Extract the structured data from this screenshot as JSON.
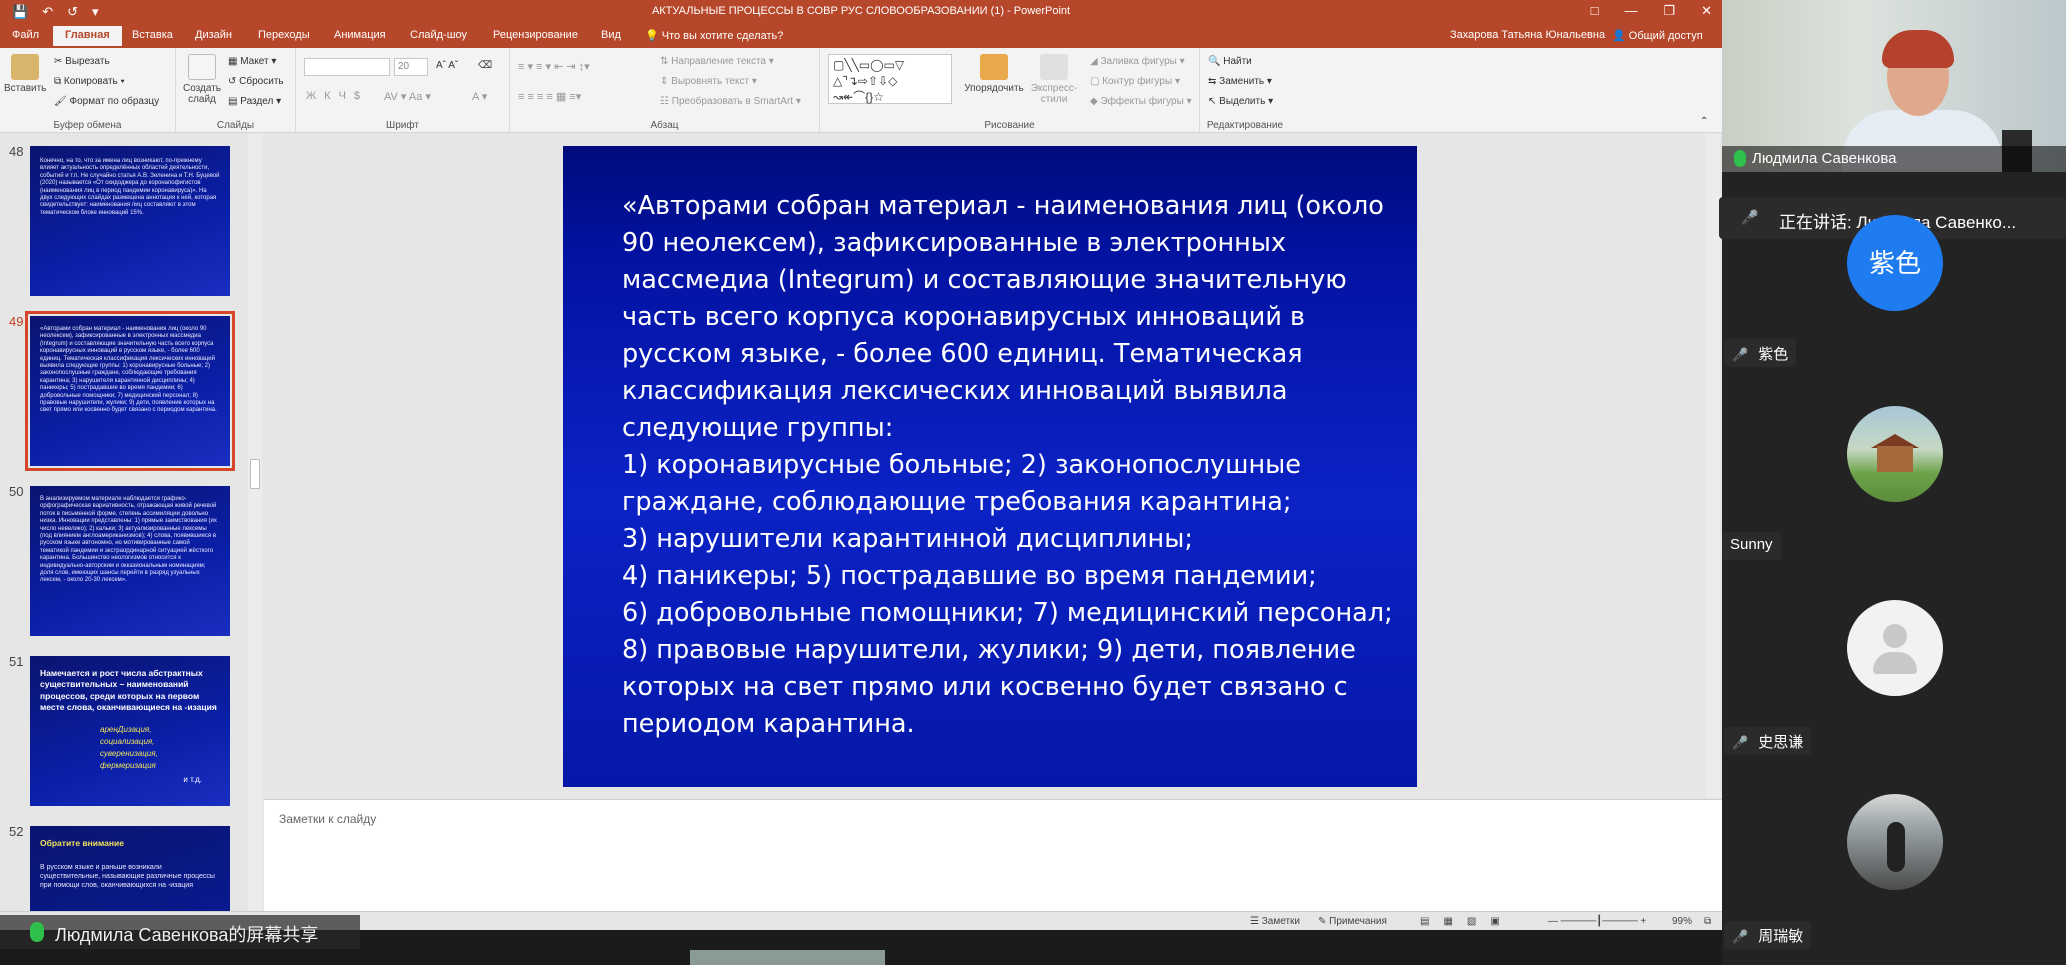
{
  "titlebar": {
    "title": "АКТУАЛЬНЫЕ ПРОЦЕССЫ В СОВР РУС СЛОВООБРАЗОВАНИИ (1) - PowerPoint",
    "save_icon": "save-icon",
    "undo_icon": "undo-icon",
    "redo_icon": "redo-icon"
  },
  "tabs": {
    "file": "Файл",
    "home": "Главная",
    "insert": "Вставка",
    "design": "Дизайн",
    "transitions": "Переходы",
    "animations": "Анимация",
    "slideshow": "Слайд-шоу",
    "review": "Рецензирование",
    "view": "Вид",
    "tell_me": "Что вы хотите сделать?",
    "user": "Захарова Татьяна Юнальевна",
    "share": "Общий доступ"
  },
  "ribbon": {
    "paste": "Вставить",
    "cut": "Вырезать",
    "copy": "Копировать",
    "format_painter": "Формат по образцу",
    "clipboard_group": "Буфер обмена",
    "new_slide": "Создать слайд",
    "layout": "Макет",
    "reset": "Сбросить",
    "section": "Раздел",
    "slides_group": "Слайды",
    "font_size": "20",
    "font_group": "Шрифт",
    "text_direction": "Направление текста",
    "align_text": "Выровнять текст",
    "smartart": "Преобразовать в SmartArt",
    "paragraph_group": "Абзац",
    "arrange": "Упорядочить",
    "quick_styles": "Экспресс-стили",
    "shape_fill": "Заливка фигуры",
    "shape_outline": "Контур фигуры",
    "shape_effects": "Эффекты фигуры",
    "drawing_group": "Рисование",
    "find": "Найти",
    "replace": "Заменить",
    "select": "Выделить",
    "editing_group": "Редактирование"
  },
  "thumbnails": [
    {
      "num": "48",
      "text": "Конечно, на то, что за имена лиц возникают, по-прежнему влияет актуальность определённых областей деятельности, событий и т.п. Не случайно статья А.В. Зеленина и Т.Н. Буцевой (2020) называется «От скидоджера до коронапофигистов (наименования лиц в период пандемии коронавируса)». На двух следующих слайдах размещена аннотация к ней, которая свидетельствует: наименования лиц составляют в этом тематическом блоке инноваций 15%."
    },
    {
      "num": "49",
      "text": "«Авторами собран материал - наименования лиц (около 90 неолексем), зафиксированные в электронных массмедиа (Integrum) и составляющие значительную часть всего корпуса коронавирусных инноваций в русском языке, - более 600 единиц. Тематическая классификация лексических инноваций выявила следующие группы: 1) коронавирусные больные; 2) законопослушные граждане, соблюдающие требования карантина; 3) нарушители карантинной дисциплины; 4) паникеры; 5) пострадавшие во время пандемии; 6) добровольные помощники; 7) медицинский персонал; 8) правовые нарушители, жулики; 9) дети, появление которых на свет прямо или косвенно будет связано с периодом карантина."
    },
    {
      "num": "50",
      "text": "В анализируемом материале наблюдается графико-орфографическая вариативность, отражающая живой речевой поток в письменной форме, степень ассимиляции довольно низка. Инновации представлены: 1) прямые заимствования (их число невелико); 2) кальки; 3) актуализированные лексемы (под влиянием англоамериканизмов); 4) слова, появившиеся в русском языке автономно, но мотивированные самой тематикой пандемии и экстраординарной ситуацией жёсткого карантина. Большинство неологизмов относится к индивидуально-авторским и окказиональным номинациям; доля слов, имеющих шансы перейти в разряд узуальных лексем, - около 20-30 лексем»."
    },
    {
      "num": "51",
      "title": "Намечается и рост числа абстрактных существительных – наименований процессов, среди которых на первом месте слова, оканчивающиеся на -изация",
      "items": [
        "аренДизация,",
        "социализация,",
        "суверенизация,",
        "фермеризация"
      ],
      "tail": "и т.д."
    },
    {
      "num": "52",
      "title": "Обратите внимание",
      "text": "В русском языке и раньше возникали существительные, называющие различные процессы при помощи слов, оканчивающихся на -изация"
    }
  ],
  "slide": {
    "text": "«Авторами собран материал - наименования лиц (около 90 неолексем), зафиксированные в электронных массмедиа (Integrum) и составляющие значительную часть всего корпуса коронавирусных инноваций в русском языке, - более 600 единиц. Тематическая классификация лексических инноваций выявила следующие группы:\n1) коронавирусные больные; 2) законопослушные граждане, соблюдающие требования карантина;\n3) нарушители карантинной дисциплины;\n4) паникеры; 5) пострадавшие во время пандемии;\n6) добровольные помощники; 7) медицинский персонал; 8) правовые нарушители, жулики; 9) дети, появление которых на свет прямо или косвенно будет связано с периодом карантина."
  },
  "notes": {
    "placeholder": "Заметки к слайду"
  },
  "status": {
    "notes": "Заметки",
    "comments": "Примечания",
    "zoom": "99%"
  },
  "share_label": "Людмила Савенкова的屏幕共享",
  "participants": {
    "main_speaker": "Людмила Савенкова",
    "speaking_label": "正在讲话: Людмила Савенко...",
    "list": [
      {
        "name": "紫色",
        "avatar_text": "紫色"
      },
      {
        "name": "Sunny"
      },
      {
        "name": "史思谦"
      },
      {
        "name": "周瑞敏"
      }
    ]
  }
}
